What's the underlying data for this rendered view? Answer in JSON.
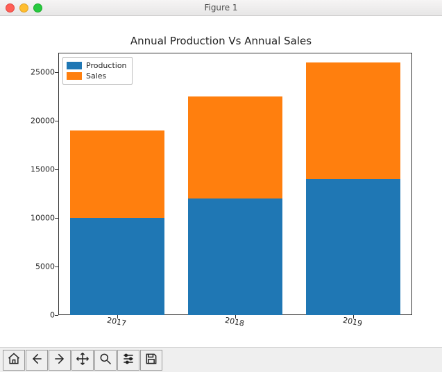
{
  "window": {
    "title": "Figure 1"
  },
  "chart_data": {
    "type": "bar",
    "stacked": true,
    "title": "Annual Production Vs Annual Sales",
    "categories": [
      "2017",
      "2018",
      "2019"
    ],
    "series": [
      {
        "name": "Production",
        "values": [
          10000,
          12000,
          14000
        ],
        "color": "#1f77b4"
      },
      {
        "name": "Sales",
        "values": [
          9000,
          10500,
          12000
        ],
        "color": "#ff7f0e"
      }
    ],
    "ylim": [
      0,
      27000
    ],
    "yticks": [
      0,
      5000,
      10000,
      15000,
      20000,
      25000
    ],
    "xlabel": "",
    "ylabel": ""
  },
  "toolbar": {
    "home": "Home",
    "back": "Back",
    "forward": "Forward",
    "pan": "Pan",
    "zoom": "Zoom",
    "configure": "Configure subplots",
    "save": "Save"
  }
}
